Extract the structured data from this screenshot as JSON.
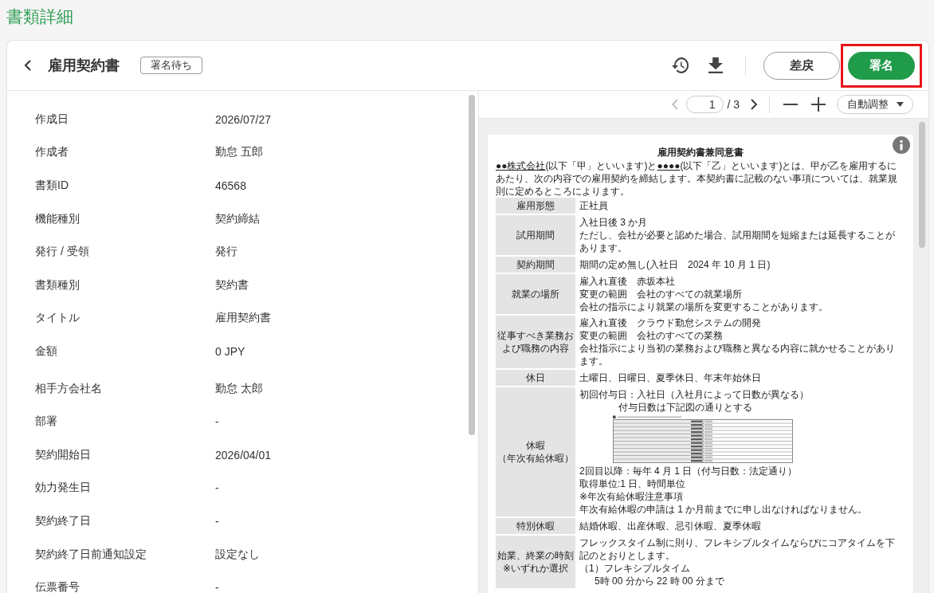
{
  "page_title": "書類詳細",
  "header": {
    "title": "雇用契約書",
    "status_badge": "署名待ち",
    "buttons": [
      {
        "kind": "outline",
        "label": "差戻",
        "highlighted": false
      },
      {
        "kind": "primary",
        "label": "署名",
        "highlighted": true
      }
    ]
  },
  "document_fields": [
    {
      "label": "作成日",
      "value": "2026/07/27"
    },
    {
      "label": "作成者",
      "value": "勤怠 五郎"
    },
    {
      "label": "書類ID",
      "value": "46568"
    },
    {
      "label": "機能種別",
      "value": "契約締結"
    },
    {
      "label": "発行 / 受領",
      "value": "発行"
    },
    {
      "label": "書類種別",
      "value": "契約書"
    },
    {
      "label": "タイトル",
      "value": "雇用契約書"
    },
    {
      "label": "金額",
      "value": "0 JPY"
    }
  ],
  "contract_fields": [
    {
      "label": "相手方会社名",
      "value": "勤怠 太郎"
    },
    {
      "label": "部署",
      "value": "-"
    },
    {
      "label": "契約開始日",
      "value": "2026/04/01"
    },
    {
      "label": "効力発生日",
      "value": "-"
    },
    {
      "label": "契約終了日",
      "value": "-"
    },
    {
      "label": "契約終了日前通知設定",
      "value": "設定なし"
    },
    {
      "label": "伝票番号",
      "value": "-"
    }
  ],
  "viewer": {
    "prev_disabled": true,
    "next_disabled": false,
    "page_input": "1",
    "page_total": "/ 3",
    "zoom_select": "自動調整",
    "document": {
      "title": "雇用契約書兼同意書",
      "intro": {
        "party_a": "●●株式会社",
        "text_1": "(以下「甲」といいます)と",
        "party_b": "●●●●",
        "text_2": "(以下「乙」といいます)とは、甲が乙を雇用するにあたり、次の内容での雇用契約を締結します。本契約書に記載のない事項については、就業規則に定めるところによります。"
      },
      "rows": [
        {
          "label": [
            "雇用形態"
          ],
          "lines": [
            {
              "kind": "text",
              "text": "正社員"
            }
          ]
        },
        {
          "label": [
            "試用期間"
          ],
          "lines": [
            {
              "kind": "text",
              "text": "入社日後 3 か月"
            },
            {
              "kind": "text",
              "text": "ただし、会社が必要と認めた場合、試用期間を短縮または延長することがあります。"
            }
          ]
        },
        {
          "label": [
            "契約期間"
          ],
          "lines": [
            {
              "kind": "text",
              "text": "期間の定め無し(入社日　2024 年 10 月 1 日)"
            }
          ]
        },
        {
          "label": [
            "就業の場所"
          ],
          "lines": [
            {
              "kind": "text",
              "text": "雇入れ直後　赤坂本社"
            },
            {
              "kind": "text",
              "text": "変更の範囲　会社のすべての就業場所"
            },
            {
              "kind": "text",
              "text": "会社の指示により就業の場所を変更することがあります。"
            }
          ]
        },
        {
          "label": [
            "従事すべき業務および職務の内容"
          ],
          "lines": [
            {
              "kind": "text",
              "text": "雇入れ直後　クラウド勤怠システムの開発"
            },
            {
              "kind": "text",
              "text": "変更の範囲　会社のすべての業務"
            },
            {
              "kind": "text",
              "text": "会社指示により当初の業務および職務と異なる内容に就かせることがあります。"
            }
          ]
        },
        {
          "label": [
            "休日"
          ],
          "lines": [
            {
              "kind": "text",
              "text": "土曜日、日曜日、夏季休日、年末年始休日"
            }
          ]
        },
        {
          "label": [
            "休暇",
            "（年次有給休暇）"
          ],
          "lines": [
            {
              "kind": "text",
              "text": "初回付与日：入社日（入社月によって日数が異なる）"
            },
            {
              "kind": "wide_indent",
              "text": "付与日数は下記図の通りとする"
            },
            {
              "kind": "table"
            },
            {
              "kind": "text",
              "text": "2回目以降：毎年 4 月 1 日（付与日数：法定通り）"
            },
            {
              "kind": "text",
              "text": "取得単位:1 日、時間単位"
            },
            {
              "kind": "text",
              "text": "※年次有給休暇注意事項"
            },
            {
              "kind": "text",
              "text": "年次有給休暇の申請は 1 か月前までに申し出なければなりません。"
            }
          ]
        },
        {
          "label": [
            "特別休暇"
          ],
          "lines": [
            {
              "kind": "text",
              "text": "結婚休暇、出産休暇、忌引休暇、夏季休暇"
            }
          ]
        },
        {
          "label": [
            "始業、終業の時刻",
            "※いずれか選択"
          ],
          "lines": [
            {
              "kind": "text",
              "text": "フレックスタイム制に則り、フレキシブルタイムならびにコアタイムを下記のとおりとします。"
            },
            {
              "kind": "text",
              "text": "（1）フレキシブルタイム"
            },
            {
              "kind": "indent",
              "text": "5時 00 分から 22 時 00 分まで"
            }
          ]
        }
      ]
    }
  }
}
